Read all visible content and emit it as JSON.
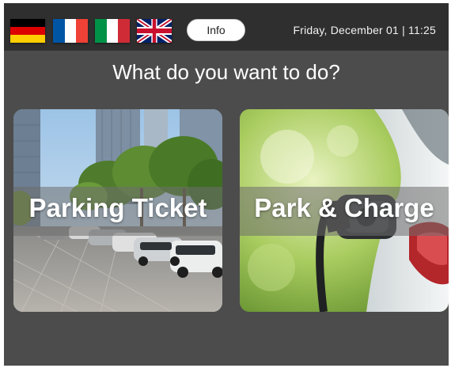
{
  "header": {
    "languages": [
      {
        "name": "German",
        "flag": "de-flag-icon"
      },
      {
        "name": "French",
        "flag": "fr-flag-icon"
      },
      {
        "name": "Italian",
        "flag": "it-flag-icon"
      },
      {
        "name": "English",
        "flag": "uk-flag-icon"
      }
    ],
    "info_label": "Info",
    "datetime": "Friday, December 01 | 11:25"
  },
  "main": {
    "question": "What do you want to do?",
    "options": [
      {
        "label": "Parking Ticket"
      },
      {
        "label": "Park & Charge"
      }
    ]
  },
  "colors": {
    "screen_bg": "#4c4c4c",
    "topbar_bg": "#2f2f2f",
    "text": "#ffffff"
  }
}
